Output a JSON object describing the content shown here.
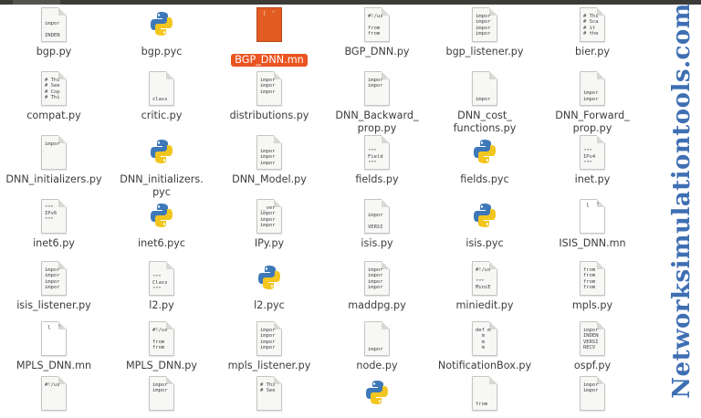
{
  "watermark": "Networksimulationtools.com",
  "files": [
    {
      "name": "bgp.py",
      "kind": "doc",
      "snippet": "impor\n\nINDEN",
      "snipBottom": true
    },
    {
      "name": "bgp.pyc",
      "kind": "pyc"
    },
    {
      "name": "BGP_DNN.mn",
      "kind": "orange",
      "snippet": "{  \"",
      "selected": true
    },
    {
      "name": "BGP_DNN.py",
      "kind": "doc",
      "snippet": "#!/us\n\nfrom\nfrom"
    },
    {
      "name": "bgp_listener.py",
      "kind": "doc",
      "snippet": "impor\nimpor\nimpor\nimpor"
    },
    {
      "name": "bier.py",
      "kind": "doc",
      "snippet": "# Thi\n# Sca\n# it\n# the"
    },
    {
      "name": "compat.py",
      "kind": "doc",
      "snippet": "# Thi\n# See\n# Cop\n# Thi"
    },
    {
      "name": "critic.py",
      "kind": "doc",
      "snippet": "class",
      "snipBottom": true
    },
    {
      "name": "distributions.py",
      "kind": "doc",
      "snippet": "impor\nimpor\nimpor"
    },
    {
      "name": "DNN_Backward_\nprop.py",
      "kind": "doc",
      "snippet": "impor\nimpor"
    },
    {
      "name": "DNN_cost_\nfunctions.py",
      "kind": "doc",
      "snippet": "impor",
      "snipBottom": true
    },
    {
      "name": "DNN_Forward_\nprop.py",
      "kind": "doc",
      "snippet": "impor\nimpor",
      "snipBottom": true
    },
    {
      "name": "DNN_initializers.py",
      "kind": "doc",
      "snippet": "impor"
    },
    {
      "name": "DNN_initializers.\npyc",
      "kind": "pyc"
    },
    {
      "name": "DNN_Model.py",
      "kind": "doc",
      "snippet": "impor\nimpor\nimpor",
      "snipBottom": true
    },
    {
      "name": "fields.py",
      "kind": "doc",
      "snippet": "\"\"\"\nField\n\"\"\"",
      "snipBottom": true
    },
    {
      "name": "fields.pyc",
      "kind": "pyc"
    },
    {
      "name": "inet.py",
      "kind": "doc",
      "snippet": "\"\"\"\nIPv4\n\"\"\"",
      "snipBottom": true
    },
    {
      "name": "inet6.py",
      "kind": "doc",
      "snippet": "\"\"\"\nIPv6\n\"\"\""
    },
    {
      "name": "inet6.pyc",
      "kind": "pyc"
    },
    {
      "name": "IPy.py",
      "kind": "doc",
      "snippet": "__ver\nimpor\nimpor\nimpor"
    },
    {
      "name": "isis.py",
      "kind": "doc",
      "snippet": "impor\n\nVERSI",
      "snipBottom": true
    },
    {
      "name": "isis.pyc",
      "kind": "pyc"
    },
    {
      "name": "ISIS_DNN.mn",
      "kind": "docmn",
      "snippet": "{  \""
    },
    {
      "name": "isis_listener.py",
      "kind": "doc",
      "snippet": "impor\nimpor\nimpor\nimpor"
    },
    {
      "name": "l2.py",
      "kind": "doc",
      "snippet": "\"\"\"\nClass\n\"\"\"",
      "snipBottom": true
    },
    {
      "name": "l2.pyc",
      "kind": "pyc"
    },
    {
      "name": "maddpg.py",
      "kind": "doc",
      "snippet": "impor\nimpor\nimpor\nimpor"
    },
    {
      "name": "miniedit.py",
      "kind": "doc",
      "snippet": "#!/us\n\n\"\"\"\nMiniE"
    },
    {
      "name": "mpls.py",
      "kind": "doc",
      "snippet": "from\nfrom\nfrom\nfrom"
    },
    {
      "name": "MPLS_DNN.mn",
      "kind": "docmn",
      "snippet": "{  \""
    },
    {
      "name": "MPLS_DNN.py",
      "kind": "doc",
      "snippet": "#!/us\n\nfrom\nfrom"
    },
    {
      "name": "mpls_listener.py",
      "kind": "doc",
      "snippet": "impor\nimpor\nimpor\nimpor"
    },
    {
      "name": "node.py",
      "kind": "doc",
      "snippet": "impor",
      "snipBottom": true
    },
    {
      "name": "NotificationBox.py",
      "kind": "doc",
      "snippet": "def m\n  m\n  m\n  m"
    },
    {
      "name": "ospf.py",
      "kind": "doc",
      "snippet": "impor\nINDEN\nVERSI\nRECV"
    },
    {
      "name": "",
      "kind": "doc",
      "snippet": "#!/us"
    },
    {
      "name": "",
      "kind": "doc",
      "snippet": "impor\nimpor"
    },
    {
      "name": "",
      "kind": "doc",
      "snippet": "# Thi\n# See"
    },
    {
      "name": "",
      "kind": "pyc"
    },
    {
      "name": "",
      "kind": "doc",
      "snippet": "from",
      "snipBottom": true
    },
    {
      "name": "",
      "kind": "doc",
      "snippet": "impor\nimpor"
    }
  ]
}
